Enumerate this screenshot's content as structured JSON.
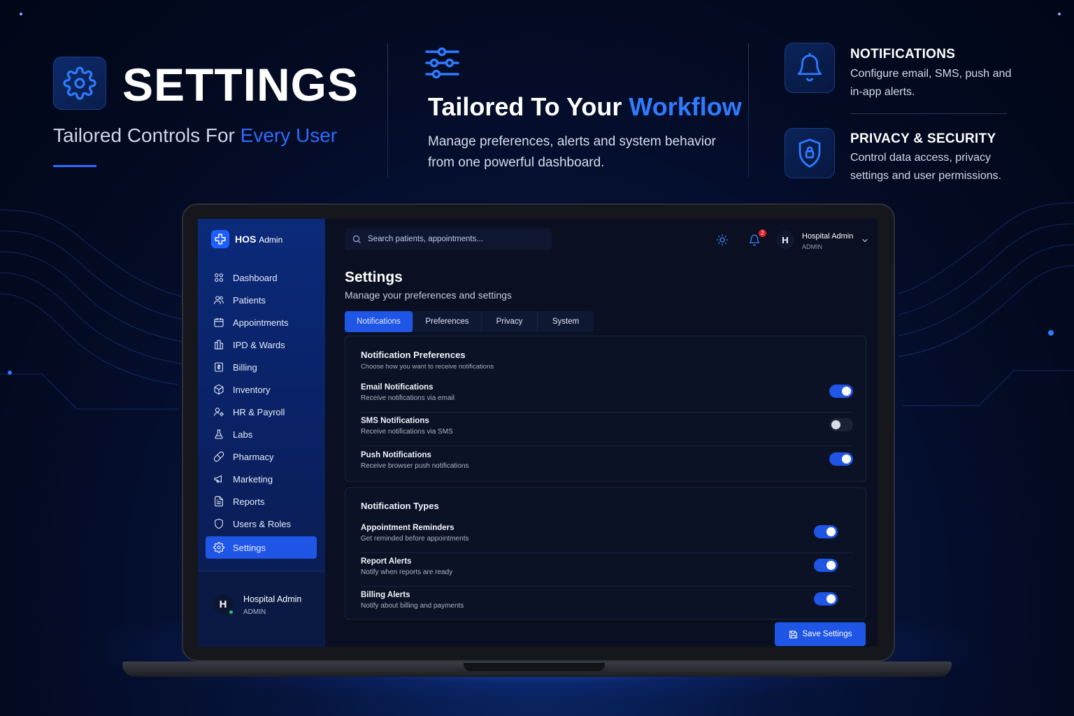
{
  "hero": {
    "title": "SETTINGS",
    "subtitle_plain": "Tailored Controls For ",
    "subtitle_highlight": "Every User"
  },
  "middle": {
    "title_plain": "Tailored To Your ",
    "title_highlight": "Workflow",
    "description": "Manage preferences, alerts and system behavior from one powerful dashboard."
  },
  "features": [
    {
      "icon": "bell-icon",
      "title": "NOTIFICATIONS",
      "description": "Configure email, SMS, push and in-app alerts."
    },
    {
      "icon": "shield-lock-icon",
      "title": "PRIVACY & SECURITY",
      "description": "Control data access, privacy settings and user permissions."
    }
  ],
  "app": {
    "brand": "HOS",
    "brand_suffix": "Admin",
    "search_placeholder": "Search patients, appointments...",
    "notification_count": "2",
    "user": {
      "initial": "H",
      "name": "Hospital Admin",
      "role": "ADMIN"
    },
    "sidebar": {
      "items": [
        {
          "label": "Dashboard",
          "icon": "dashboard-icon",
          "active": false
        },
        {
          "label": "Patients",
          "icon": "patients-icon",
          "active": false
        },
        {
          "label": "Appointments",
          "icon": "calendar-icon",
          "active": false
        },
        {
          "label": "IPD & Wards",
          "icon": "building-icon",
          "active": false
        },
        {
          "label": "Billing",
          "icon": "billing-icon",
          "active": false
        },
        {
          "label": "Inventory",
          "icon": "box-icon",
          "active": false
        },
        {
          "label": "HR & Payroll",
          "icon": "user-cog-icon",
          "active": false
        },
        {
          "label": "Labs",
          "icon": "flask-icon",
          "active": false
        },
        {
          "label": "Pharmacy",
          "icon": "pill-icon",
          "active": false
        },
        {
          "label": "Marketing",
          "icon": "megaphone-icon",
          "active": false
        },
        {
          "label": "Reports",
          "icon": "document-icon",
          "active": false
        },
        {
          "label": "Users & Roles",
          "icon": "shield-icon",
          "active": false
        },
        {
          "label": "Settings",
          "icon": "gear-icon",
          "active": true
        }
      ]
    },
    "page": {
      "title": "Settings",
      "subtitle": "Manage your preferences and settings"
    },
    "tabs": [
      {
        "label": "Notifications",
        "active": true
      },
      {
        "label": "Preferences",
        "active": false
      },
      {
        "label": "Privacy",
        "active": false
      },
      {
        "label": "System",
        "active": false
      }
    ],
    "preferences_card": {
      "title": "Notification Preferences",
      "subtitle": "Choose how you want to receive notifications",
      "rows": [
        {
          "title": "Email Notifications",
          "description": "Receive notifications via email",
          "enabled": true
        },
        {
          "title": "SMS Notifications",
          "description": "Receive notifications via SMS",
          "enabled": false
        },
        {
          "title": "Push Notifications",
          "description": "Receive browser push notifications",
          "enabled": true
        }
      ]
    },
    "types_card": {
      "title": "Notification Types",
      "rows": [
        {
          "title": "Appointment Reminders",
          "description": "Get reminded before appointments",
          "enabled": true
        },
        {
          "title": "Report Alerts",
          "description": "Notify when reports are ready",
          "enabled": true
        },
        {
          "title": "Billing Alerts",
          "description": "Notify about billing and payments",
          "enabled": true
        }
      ]
    },
    "save_label": "Save Settings"
  },
  "colors": {
    "accent": "#1f56e6",
    "highlight_text": "#2f6bff",
    "background": "#030a22",
    "sidebar": "#0a2266"
  }
}
